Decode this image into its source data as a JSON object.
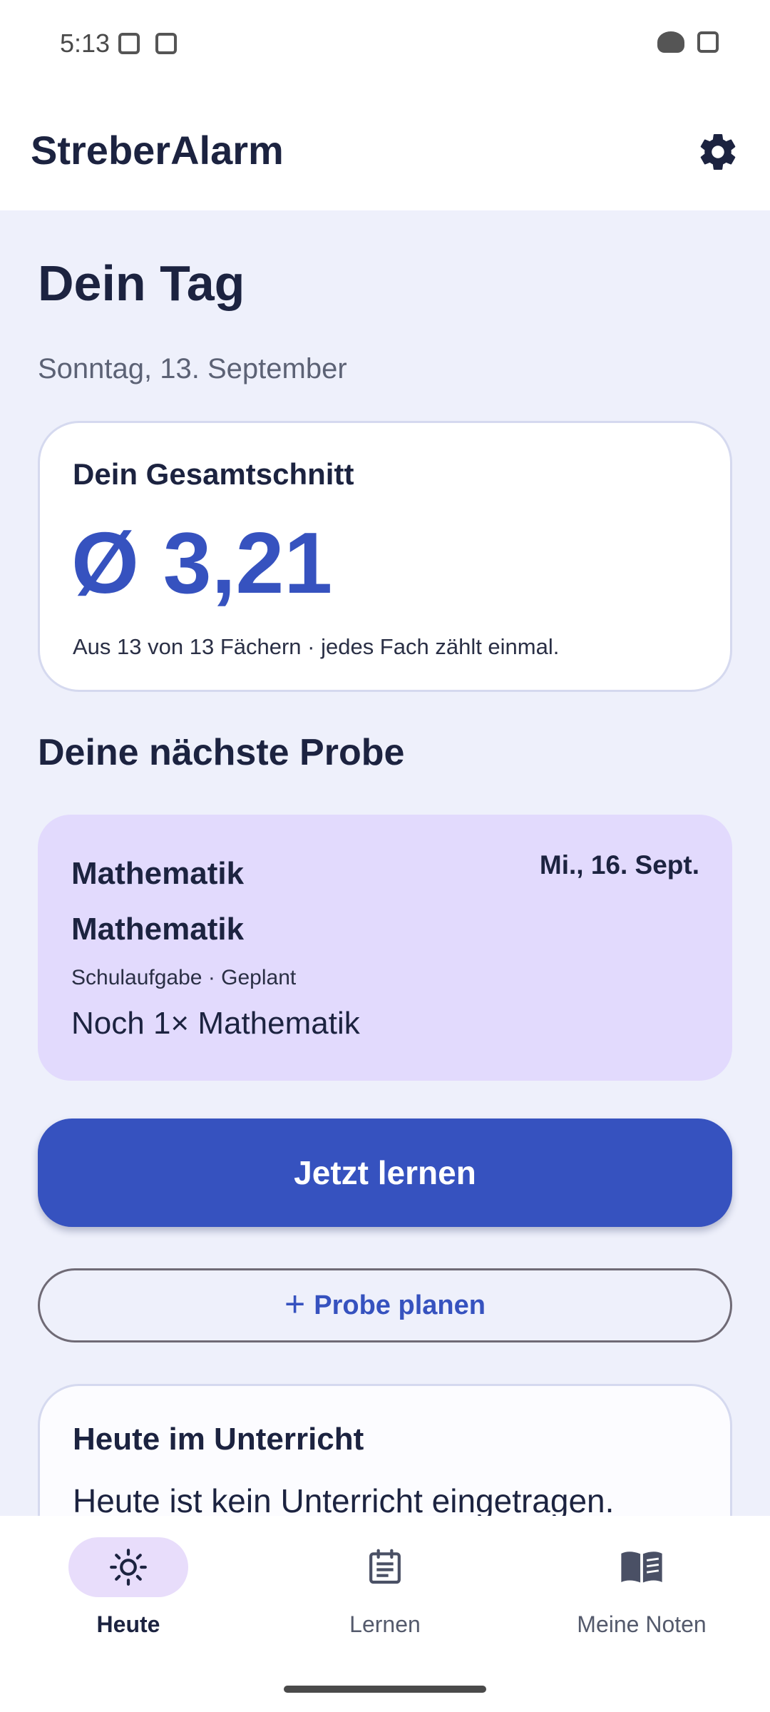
{
  "status_bar": {
    "time": "5:13"
  },
  "app_bar": {
    "title": "StreberAlarm"
  },
  "page": {
    "title": "Dein Tag",
    "date": "Sonntag, 13. September"
  },
  "average_card": {
    "label": "Dein Gesamtschnitt",
    "value": "Ø 3,21",
    "subtitle": "Aus 13 von 13 Fächern · jedes Fach zählt einmal."
  },
  "next_exam": {
    "section_title": "Deine nächste Probe",
    "subject_line1": "Mathematik",
    "subject_line2": "Mathematik",
    "date": "Mi., 16. Sept.",
    "meta": "Schulaufgabe · Geplant",
    "remaining": "Noch 1× Mathematik"
  },
  "actions": {
    "learn_label": "Jetzt lernen",
    "plan_label": "Probe planen"
  },
  "today_class": {
    "title": "Heute im Unterricht",
    "text": "Heute ist kein Unterricht eingetragen."
  },
  "bottom_nav": {
    "items": [
      {
        "label": "Heute",
        "icon": "sun-icon",
        "active": true
      },
      {
        "label": "Lernen",
        "icon": "list-icon",
        "active": false
      },
      {
        "label": "Meine Noten",
        "icon": "book-icon",
        "active": false
      }
    ]
  },
  "colors": {
    "primary": "#3652bf",
    "content_background": "#eef0fb",
    "exam_card": "#e2dafd",
    "active_nav_pill": "#e8ddfb",
    "text_dark": "#1c2340"
  }
}
